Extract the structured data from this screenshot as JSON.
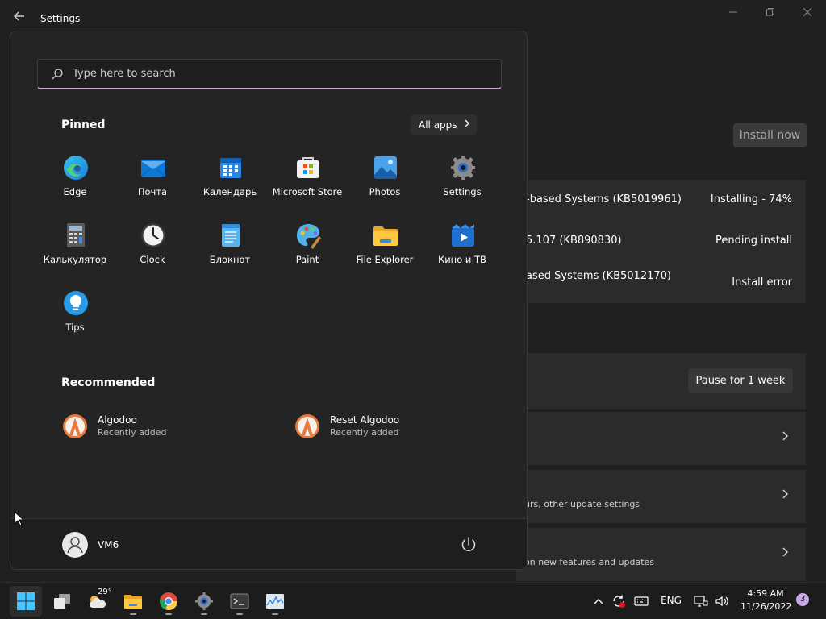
{
  "window": {
    "title": "Settings",
    "install_now": "Install now",
    "updates": [
      {
        "name": "-based Systems (KB5019961)",
        "status": "Installing - 74%"
      },
      {
        "name": "5.107 (KB890830)",
        "status": "Pending install"
      },
      {
        "name": "ased Systems (KB5012170)",
        "status": "Install error"
      }
    ],
    "pause_label": "Pause for 1 week",
    "rows": [
      {
        "sub": ""
      },
      {
        "sub": "urs, other update settings"
      },
      {
        "sub": "on new features and updates"
      }
    ]
  },
  "start": {
    "search_placeholder": "Type here to search",
    "pinned_title": "Pinned",
    "all_apps": "All apps",
    "pinned": [
      {
        "label": "Edge",
        "icon": "edge-icon"
      },
      {
        "label": "Почта",
        "icon": "mail-icon"
      },
      {
        "label": "Календарь",
        "icon": "calendar-icon"
      },
      {
        "label": "Microsoft Store",
        "icon": "store-icon"
      },
      {
        "label": "Photos",
        "icon": "photos-icon"
      },
      {
        "label": "Settings",
        "icon": "settings-icon"
      },
      {
        "label": "Калькулятор",
        "icon": "calculator-icon"
      },
      {
        "label": "Clock",
        "icon": "clock-icon"
      },
      {
        "label": "Блокнот",
        "icon": "notepad-icon"
      },
      {
        "label": "Paint",
        "icon": "paint-icon"
      },
      {
        "label": "File Explorer",
        "icon": "folder-icon"
      },
      {
        "label": "Кино и ТВ",
        "icon": "movies-icon"
      },
      {
        "label": "Tips",
        "icon": "tips-icon"
      }
    ],
    "recommended_title": "Recommended",
    "recommended": [
      {
        "name": "Algodoo",
        "sub": "Recently added"
      },
      {
        "name": "Reset Algodoo",
        "sub": "Recently added"
      }
    ],
    "user": "VM6"
  },
  "taskbar": {
    "weather_temp": "29°",
    "lang": "ENG",
    "time": "4:59 AM",
    "date": "11/26/2022",
    "notifications": "3"
  },
  "colors": {
    "accent": "#c9a8d4",
    "background": "#202020",
    "panel": "#2b2b2b"
  }
}
